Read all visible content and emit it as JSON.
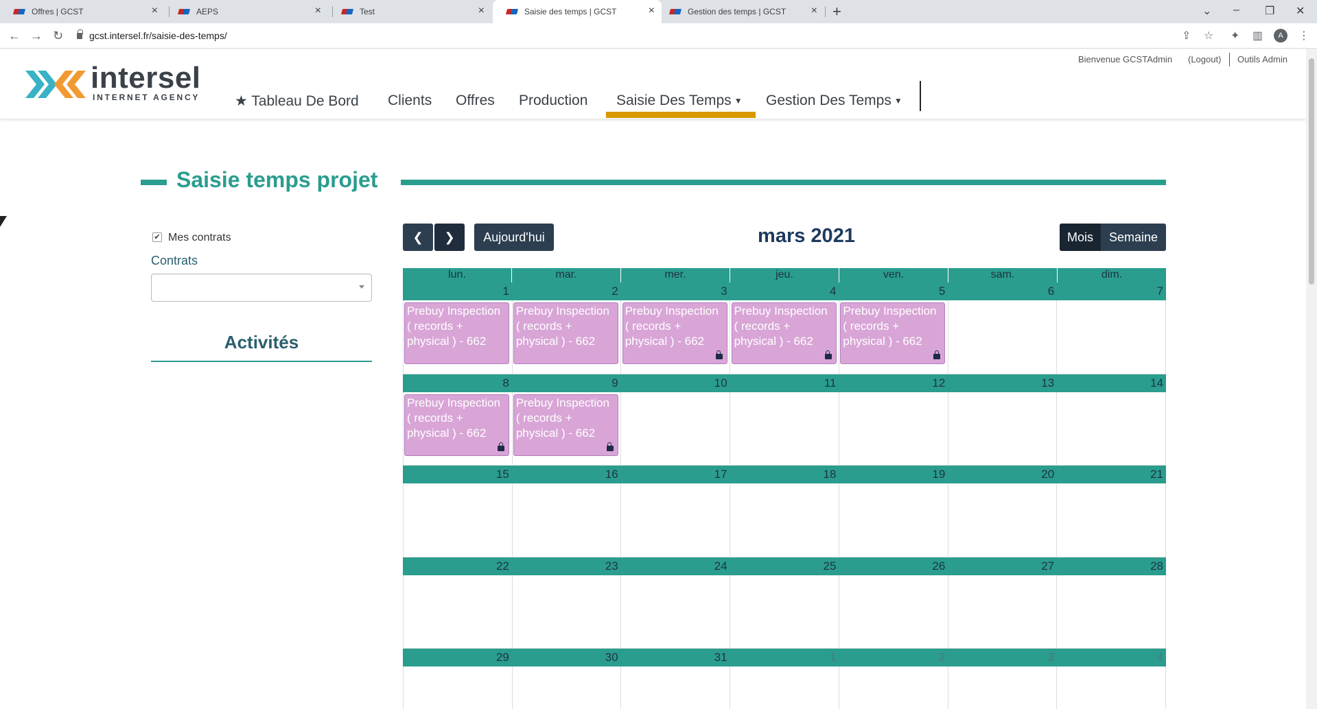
{
  "browser": {
    "tabs": [
      {
        "title": "Offres | GCST"
      },
      {
        "title": "AEPS"
      },
      {
        "title": "Test"
      },
      {
        "title": "Saisie des temps | GCST"
      },
      {
        "title": "Gestion des temps | GCST"
      }
    ],
    "url": "gcst.intersel.fr/saisie-des-temps/",
    "profile_initial": "A"
  },
  "site": {
    "logo_text": "intersel",
    "logo_subtext": "INTERNET AGENCY",
    "welcome": "Bienvenue GCSTAdmin",
    "logout": "(Logout)",
    "admin_tools": "Outils Admin",
    "nav": {
      "dashboard": "Tableau De Bord",
      "clients": "Clients",
      "offres": "Offres",
      "production": "Production",
      "saisie": "Saisie Des Temps",
      "gestion": "Gestion Des Temps"
    }
  },
  "page": {
    "title": "Saisie temps projet",
    "mes_contrats": "Mes contrats",
    "contrats_label": "Contrats",
    "activites": "Activités"
  },
  "calendar": {
    "today_button": "Aujourd'hui",
    "title": "mars 2021",
    "view_month": "Mois",
    "view_week": "Semaine",
    "weekdays": [
      "lun.",
      "mar.",
      "mer.",
      "jeu.",
      "ven.",
      "sam.",
      "dim."
    ],
    "weeks": [
      {
        "days": [
          "1",
          "2",
          "3",
          "4",
          "5",
          "6",
          "7"
        ],
        "other": [
          false,
          false,
          false,
          false,
          false,
          false,
          false
        ]
      },
      {
        "days": [
          "8",
          "9",
          "10",
          "11",
          "12",
          "13",
          "14"
        ],
        "other": [
          false,
          false,
          false,
          false,
          false,
          false,
          false
        ]
      },
      {
        "days": [
          "15",
          "16",
          "17",
          "18",
          "19",
          "20",
          "21"
        ],
        "other": [
          false,
          false,
          false,
          false,
          false,
          false,
          false
        ]
      },
      {
        "days": [
          "22",
          "23",
          "24",
          "25",
          "26",
          "27",
          "28"
        ],
        "other": [
          false,
          false,
          false,
          false,
          false,
          false,
          false
        ]
      },
      {
        "days": [
          "29",
          "30",
          "31",
          "1",
          "2",
          "3",
          "4"
        ],
        "other": [
          false,
          false,
          false,
          true,
          true,
          true,
          true
        ]
      }
    ],
    "events": [
      {
        "week": 0,
        "day": 0,
        "title": "Prebuy Inspection ( records + physical ) - 662",
        "locked": false
      },
      {
        "week": 0,
        "day": 1,
        "title": "Prebuy Inspection ( records + physical ) - 662",
        "locked": false
      },
      {
        "week": 0,
        "day": 2,
        "title": "Prebuy Inspection ( records + physical ) - 662",
        "locked": true
      },
      {
        "week": 0,
        "day": 3,
        "title": "Prebuy Inspection ( records + physical ) - 662",
        "locked": true
      },
      {
        "week": 0,
        "day": 4,
        "title": "Prebuy Inspection ( records + physical ) - 662",
        "locked": true
      },
      {
        "week": 1,
        "day": 0,
        "title": "Prebuy Inspection ( records + physical ) - 662",
        "locked": true
      },
      {
        "week": 1,
        "day": 1,
        "title": "Prebuy Inspection ( records + physical ) - 662",
        "locked": true
      }
    ]
  },
  "colors": {
    "teal": "#2a9d8f",
    "navy": "#2c3e50",
    "event_bg": "#d8a5d6",
    "active_nav": "#d99700"
  }
}
